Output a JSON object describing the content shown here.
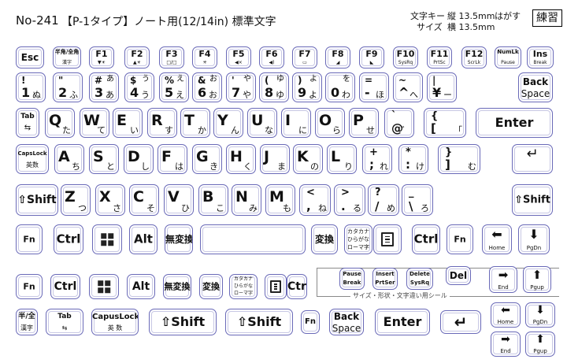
{
  "header": {
    "model": "No-241",
    "title": "【P-1タイプ】ノート用(12/14in) 標準文字",
    "size_label_a": "文字キー",
    "size_vertical": "縦 13.5mm",
    "peel_label": "はがす",
    "size_label_b": "サイズ",
    "size_horizontal": "横 13.5mm",
    "stamp": "練習"
  },
  "separator_label": "サイズ・形状・文字違い用シール",
  "row_function": [
    {
      "id": "esc",
      "main": "Esc",
      "sub": ""
    },
    {
      "id": "hankaku",
      "main": "半角/全角",
      "sub": "漢字"
    },
    {
      "id": "f1",
      "main": "F1",
      "sub": "▼☀"
    },
    {
      "id": "f2",
      "main": "F2",
      "sub": "▲☀"
    },
    {
      "id": "f3",
      "main": "F3",
      "sub": "□/□"
    },
    {
      "id": "f4",
      "main": "F4",
      "sub": "✳"
    },
    {
      "id": "f5",
      "main": "F5",
      "sub": "◀×"
    },
    {
      "id": "f6",
      "main": "F6",
      "sub": "◀)"
    },
    {
      "id": "f7",
      "main": "F7",
      "sub": "▭"
    },
    {
      "id": "f8",
      "main": "F8",
      "sub": "◢"
    },
    {
      "id": "f9",
      "main": "F9",
      "sub": "◣"
    },
    {
      "id": "f10",
      "main": "F10",
      "sub": "SysRq"
    },
    {
      "id": "f11",
      "main": "F11",
      "sub": "PrtSc"
    },
    {
      "id": "f12",
      "main": "F12",
      "sub": "ScrLk"
    },
    {
      "id": "numlk",
      "main": "NumLk",
      "sub": "Pause"
    },
    {
      "id": "ins",
      "main": "Ins",
      "sub": "Break"
    }
  ],
  "row_number": [
    {
      "id": "1",
      "tl": "!",
      "tr": "",
      "bl": "1",
      "br": "ぬ"
    },
    {
      "id": "2",
      "tl": "\"",
      "tr": "",
      "bl": "2",
      "br": "ふ"
    },
    {
      "id": "3",
      "tl": "#",
      "tr": "あ",
      "bl": "3",
      "br": "あ"
    },
    {
      "id": "4",
      "tl": "$",
      "tr": "う",
      "bl": "4",
      "br": "う"
    },
    {
      "id": "5",
      "tl": "%",
      "tr": "え",
      "bl": "5",
      "br": "え"
    },
    {
      "id": "6",
      "tl": "&",
      "tr": "お",
      "bl": "6",
      "br": "お"
    },
    {
      "id": "7",
      "tl": "'",
      "tr": "や",
      "bl": "7",
      "br": "や"
    },
    {
      "id": "8",
      "tl": "(",
      "tr": "ゆ",
      "bl": "8",
      "br": "ゆ"
    },
    {
      "id": "9",
      "tl": ")",
      "tr": "よ",
      "bl": "9",
      "br": "よ"
    },
    {
      "id": "0",
      "tl": "",
      "tr": "を",
      "bl": "0",
      "br": "わ"
    },
    {
      "id": "minus",
      "tl": "=",
      "tr": "",
      "bl": "-",
      "br": "ほ"
    },
    {
      "id": "caret",
      "tl": "~",
      "tr": "",
      "bl": "^",
      "br": "へ"
    },
    {
      "id": "yen",
      "tl": "|",
      "tr": "",
      "bl": "¥",
      "br": "ー"
    },
    {
      "id": "backspace",
      "label1": "Back",
      "label2": "Space"
    }
  ],
  "row_qwerty": [
    {
      "id": "tab",
      "label1": "Tab",
      "label2": "⇆"
    },
    {
      "id": "q",
      "main": "Q",
      "kana": "た"
    },
    {
      "id": "w",
      "main": "W",
      "kana": "て"
    },
    {
      "id": "e",
      "main": "E",
      "kana": "い"
    },
    {
      "id": "r",
      "main": "R",
      "kana": "す"
    },
    {
      "id": "t",
      "main": "T",
      "kana": "か"
    },
    {
      "id": "y",
      "main": "Y",
      "kana": "ん"
    },
    {
      "id": "u",
      "main": "U",
      "kana": "な"
    },
    {
      "id": "i",
      "main": "I",
      "kana": "に"
    },
    {
      "id": "o",
      "main": "O",
      "kana": "ら"
    },
    {
      "id": "p",
      "main": "P",
      "kana": "せ"
    },
    {
      "id": "at",
      "main": "@",
      "kana": "゛",
      "top": "`"
    },
    {
      "id": "bracket",
      "main": "[",
      "kana": "「",
      "top": "{"
    },
    {
      "id": "enter",
      "main": "Enter",
      "kana": ""
    }
  ],
  "row_asdf": [
    {
      "id": "capslock",
      "label1": "CapsLock",
      "label2": "英数"
    },
    {
      "id": "a",
      "main": "A",
      "kana": "ち"
    },
    {
      "id": "s",
      "main": "S",
      "kana": "と"
    },
    {
      "id": "d",
      "main": "D",
      "kana": "し"
    },
    {
      "id": "f",
      "main": "F",
      "kana": "は"
    },
    {
      "id": "g",
      "main": "G",
      "kana": "き"
    },
    {
      "id": "h",
      "main": "H",
      "kana": "く"
    },
    {
      "id": "j",
      "main": "J",
      "kana": "ま"
    },
    {
      "id": "k",
      "main": "K",
      "kana": "の"
    },
    {
      "id": "l",
      "main": "L",
      "kana": "り"
    },
    {
      "id": "semicolon",
      "main": ";",
      "kana": "れ",
      "top": "+"
    },
    {
      "id": "colon",
      "main": ":",
      "kana": "け",
      "top": "*"
    },
    {
      "id": "rbracket",
      "main": "]",
      "kana": "む",
      "top": "}"
    },
    {
      "id": "enter2",
      "main": "↵",
      "kana": ""
    }
  ],
  "row_zxcv": [
    {
      "id": "lshift",
      "main": "⇧Shift"
    },
    {
      "id": "z",
      "main": "Z",
      "kana": "つ"
    },
    {
      "id": "x",
      "main": "X",
      "kana": "さ"
    },
    {
      "id": "c",
      "main": "C",
      "kana": "そ"
    },
    {
      "id": "v",
      "main": "V",
      "kana": "ひ"
    },
    {
      "id": "b",
      "main": "B",
      "kana": "こ"
    },
    {
      "id": "n",
      "main": "N",
      "kana": "み"
    },
    {
      "id": "m",
      "main": "M",
      "kana": "も"
    },
    {
      "id": "comma",
      "main": ",",
      "kana": "ね",
      "top": "<"
    },
    {
      "id": "period",
      "main": ".",
      "kana": "る",
      "top": ">"
    },
    {
      "id": "slash",
      "main": "/",
      "kana": "め",
      "top": "?"
    },
    {
      "id": "backslash",
      "main": "\\",
      "kana": "ろ",
      "top": "_"
    },
    {
      "id": "rshift",
      "main": "⇧Shift"
    }
  ],
  "row_bottom": [
    {
      "id": "fn",
      "main": "Fn"
    },
    {
      "id": "ctrl",
      "main": "Ctrl"
    },
    {
      "id": "win",
      "main": "win"
    },
    {
      "id": "alt",
      "main": "Alt"
    },
    {
      "id": "muhenkan",
      "main": "無変換"
    },
    {
      "id": "space",
      "main": ""
    },
    {
      "id": "henkan",
      "main": "変換"
    },
    {
      "id": "kana",
      "main": "カタカナ",
      "sub1": "ひらがな",
      "sub2": "ローマ字"
    },
    {
      "id": "menu",
      "main": "menu"
    },
    {
      "id": "rctrl",
      "main": "Ctrl"
    },
    {
      "id": "rfn",
      "main": "Fn"
    },
    {
      "id": "left",
      "main": "⬅",
      "sub": "Home"
    },
    {
      "id": "down",
      "main": "⬇",
      "sub": "PgDn"
    }
  ],
  "spares_row1": [
    {
      "id": "s_fn",
      "main": "Fn"
    },
    {
      "id": "s_ctrl",
      "main": "Ctrl"
    },
    {
      "id": "s_win",
      "main": "win"
    },
    {
      "id": "s_alt",
      "main": "Alt"
    },
    {
      "id": "s_muhenkan",
      "main": "無変換"
    },
    {
      "id": "s_henkan",
      "main": "変換"
    },
    {
      "id": "s_kana",
      "main": "カタカナ",
      "sub1": "ひらがな",
      "sub2": "ローマ字"
    },
    {
      "id": "s_menu",
      "main": "menu"
    },
    {
      "id": "s_ctrl2",
      "main": "Ctrl"
    }
  ],
  "spares_cluster": [
    {
      "id": "pause",
      "label1": "Pause",
      "label2": "Break"
    },
    {
      "id": "insert",
      "label1": "Insert",
      "label2": "PrtSer"
    },
    {
      "id": "delete",
      "label1": "Delete",
      "label2": "SysRq"
    },
    {
      "id": "del",
      "label1": "Del",
      "label2": ""
    },
    {
      "id": "right_end",
      "main": "➡",
      "sub": "End"
    },
    {
      "id": "up_pgup",
      "main": "⬆",
      "sub": "Pgup"
    }
  ],
  "spares_row2": [
    {
      "id": "s_hankaku",
      "label1": "半/全",
      "label2": "漢字"
    },
    {
      "id": "s_tab",
      "label1": "Tab",
      "label2": "⇆"
    },
    {
      "id": "s_caps",
      "label1": "CapusLock",
      "label2": "英 数"
    },
    {
      "id": "s_lshift",
      "main": "⇧Shift"
    },
    {
      "id": "s_rshift",
      "main": "⇧Shift"
    },
    {
      "id": "s_fn2",
      "main": "Fn"
    },
    {
      "id": "s_backspace",
      "label1": "Back",
      "label2": "Space"
    },
    {
      "id": "s_enter",
      "main": "Enter"
    },
    {
      "id": "s_enter_arrow",
      "main": "↵"
    },
    {
      "id": "s_home",
      "main": "⬅",
      "sub": "Home"
    },
    {
      "id": "s_pgdn",
      "main": "⬇",
      "sub": "PgDn"
    },
    {
      "id": "s_end",
      "main": "➡",
      "sub": "End"
    },
    {
      "id": "s_pgup",
      "main": "⬆",
      "sub": "Pgup"
    }
  ]
}
